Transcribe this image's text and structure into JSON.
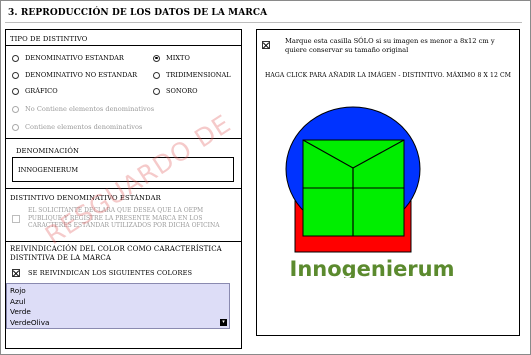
{
  "title": "3. REPRODUCCIÓN DE LOS DATOS DE LA MARCA",
  "distintivo": {
    "header": "TIPO DE DISTINTIVO",
    "options": [
      {
        "label": "DENOMINATIVO ESTANDAR",
        "selected": false
      },
      {
        "label": "MIXTO",
        "selected": true
      },
      {
        "label": "DENOMINATIVO NO ESTANDAR",
        "selected": false
      },
      {
        "label": "TRIDIMENSIONAL",
        "selected": false
      },
      {
        "label": "GRÁFICO",
        "selected": false
      },
      {
        "label": "SONORO",
        "selected": false
      }
    ],
    "sub_options": [
      "No Contiene elementos denominativos",
      "Contiene elementos denominativos"
    ]
  },
  "denominacion": {
    "header": "DENOMINACIÓN",
    "value": "INNOGENIERUM"
  },
  "estandar": {
    "header": "DISTINTIVO DENOMINATIVO ESTÁNDAR",
    "text": "EL SOLICITANTE DECLARA QUE DESEA QUE LA OEPM PUBLIQUE Y REGISTRE LA PRESENTE MARCA EN LOS CARACTERES ESTÁNDAR UTILIZADOS POR DICHA OFICINA"
  },
  "color": {
    "header": "REIVINDICACIÓN DEL COLOR COMO CARACTERÍSTICA DISTINTIVA DE LA MARCA",
    "checkbox_label": "SE REIVINDICAN LOS SIGUIENTES COLORES",
    "checked": true,
    "colors": [
      "Rojo",
      "Azul",
      "Verde",
      "VerdeOliva"
    ]
  },
  "image_panel": {
    "checkbox_text": "Marque esta casilla SÓLO si su imagen es menor a 8x12 cm y quiere conservar su tamaño original",
    "checked": true,
    "click_text": "HAGA CLICK PARA AÑADIR LA IMÁGEN -  DISTINTIVO. MÁXIMO 8 X 12 CM",
    "logo_text": "Innogenierum",
    "logo_colors": {
      "red": "#ff0000",
      "blue": "#0033ff",
      "green": "#00ee00",
      "olive": "#5b8a2e"
    }
  },
  "watermark": "RESGUARDO DE"
}
